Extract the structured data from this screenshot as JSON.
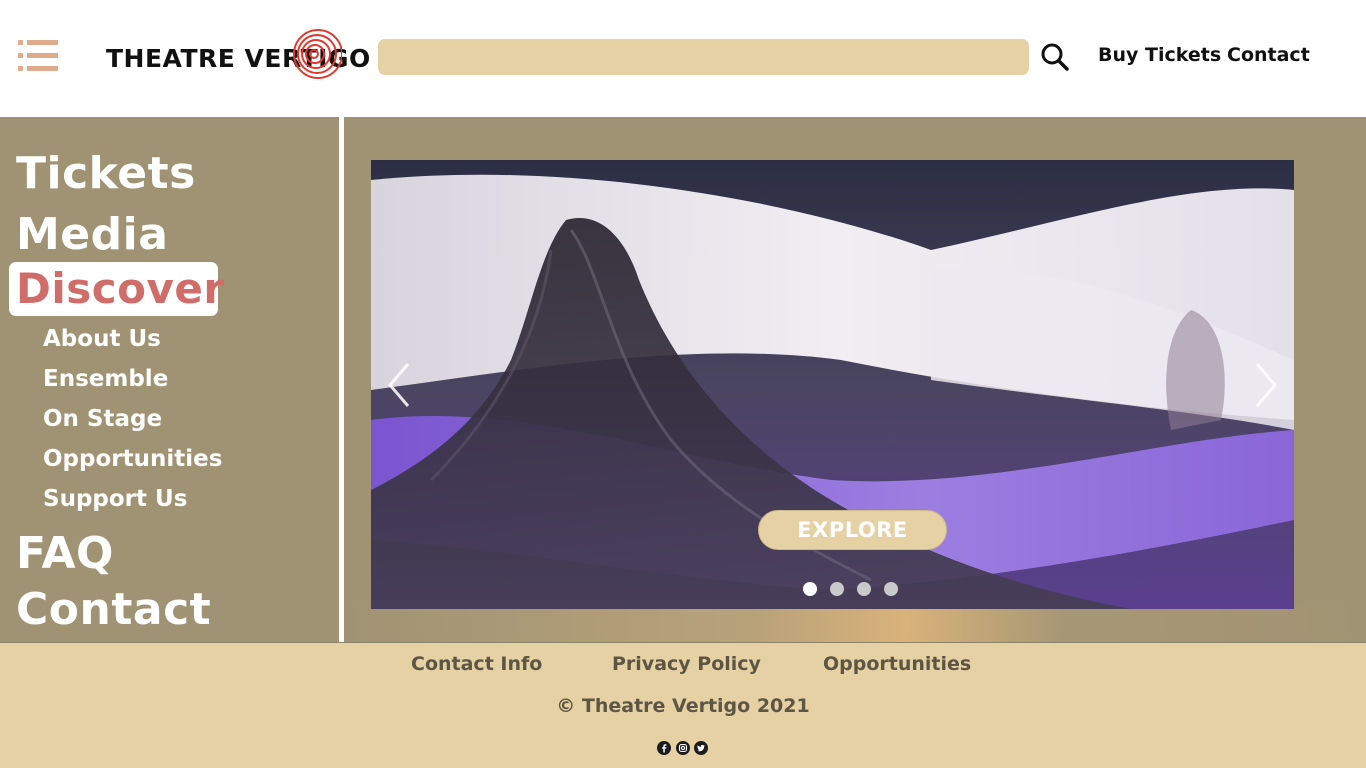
{
  "header": {
    "logo_text": "THEATRE VERTIGO",
    "search": {
      "placeholder": "",
      "value": ""
    },
    "nav": {
      "buy_tickets": "Buy Tickets",
      "contact": "Contact"
    }
  },
  "sidebar": {
    "items": [
      {
        "label": "Tickets"
      },
      {
        "label": "Media"
      },
      {
        "label": "Discover",
        "active": true
      },
      {
        "label": "FAQ"
      },
      {
        "label": "Contact"
      }
    ],
    "sub_items": [
      {
        "label": "About Us"
      },
      {
        "label": "Ensemble"
      },
      {
        "label": "On Stage"
      },
      {
        "label": "Opportunities"
      },
      {
        "label": "Support Us"
      }
    ]
  },
  "carousel": {
    "button_label": "EXPLORE",
    "slide_count": 4,
    "active_slide": 1
  },
  "footer": {
    "links": [
      "Contact Info",
      "Privacy Policy",
      "Opportunities"
    ],
    "copyright": "© Theatre Vertigo 2021",
    "social": [
      "facebook-icon",
      "instagram-icon",
      "twitter-icon"
    ]
  },
  "colors": {
    "sidebar_bg": "#a09373",
    "accent_tan": "#e5d1a3",
    "active_red": "#d06d6a",
    "menu_icon": "#e0aa8c",
    "footer_text": "#5e5644"
  }
}
